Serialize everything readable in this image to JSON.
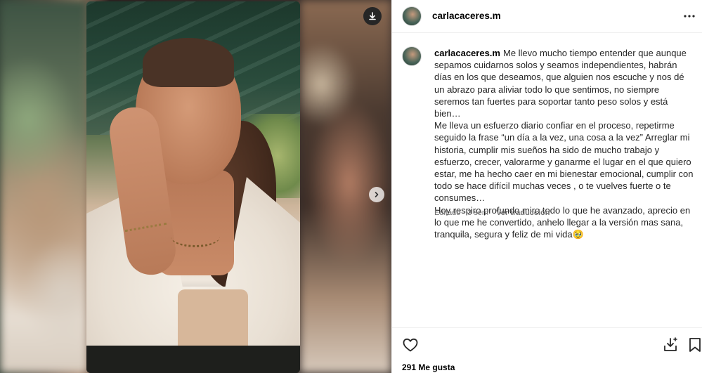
{
  "post": {
    "username": "carlacaceres.m",
    "caption_lines": [
      "Me llevo mucho tiempo entender que aunque sepamos cuidarnos solos y seamos independientes, habrán días en los que deseamos, que alguien nos escuche y nos dé un abrazo para aliviar todo lo que sentimos, no siempre seremos tan fuertes para soportar tanto peso solos y está bien…",
      "Me lleva un esfuerzo diario confiar en el proceso, repetirme seguido la frase “un día a la vez, una cosa a la vez” Arreglar mi historia, cumplir mis sueños ha sido de mucho trabajo y esfuerzo, crecer, valorarme y ganarme el lugar en el que quiero estar, me ha hecho caer en mi bienestar emocional, cumplir con todo se hace difícil muchas veces , o te vuelves fuerte o te consumes…",
      "Hoy respiro profundo miro todo lo que he avanzado, aprecio en lo que me he convertido, anhelo llegar a la versión mas sana, tranquila, segura y feliz de mi vida🥹"
    ],
    "edited_label": "Editado · 3 sem",
    "translate_label": "Ver traducción",
    "likes_label": "291 Me gusta"
  },
  "icons": {
    "download": "download-icon",
    "next": "chevron-right-icon",
    "more": "more-options-icon",
    "like": "heart-icon",
    "save_to_device": "download-icon",
    "bookmark": "bookmark-icon"
  },
  "colors": {
    "text_primary": "#000000",
    "text_secondary": "#737373",
    "divider": "#efefef"
  }
}
